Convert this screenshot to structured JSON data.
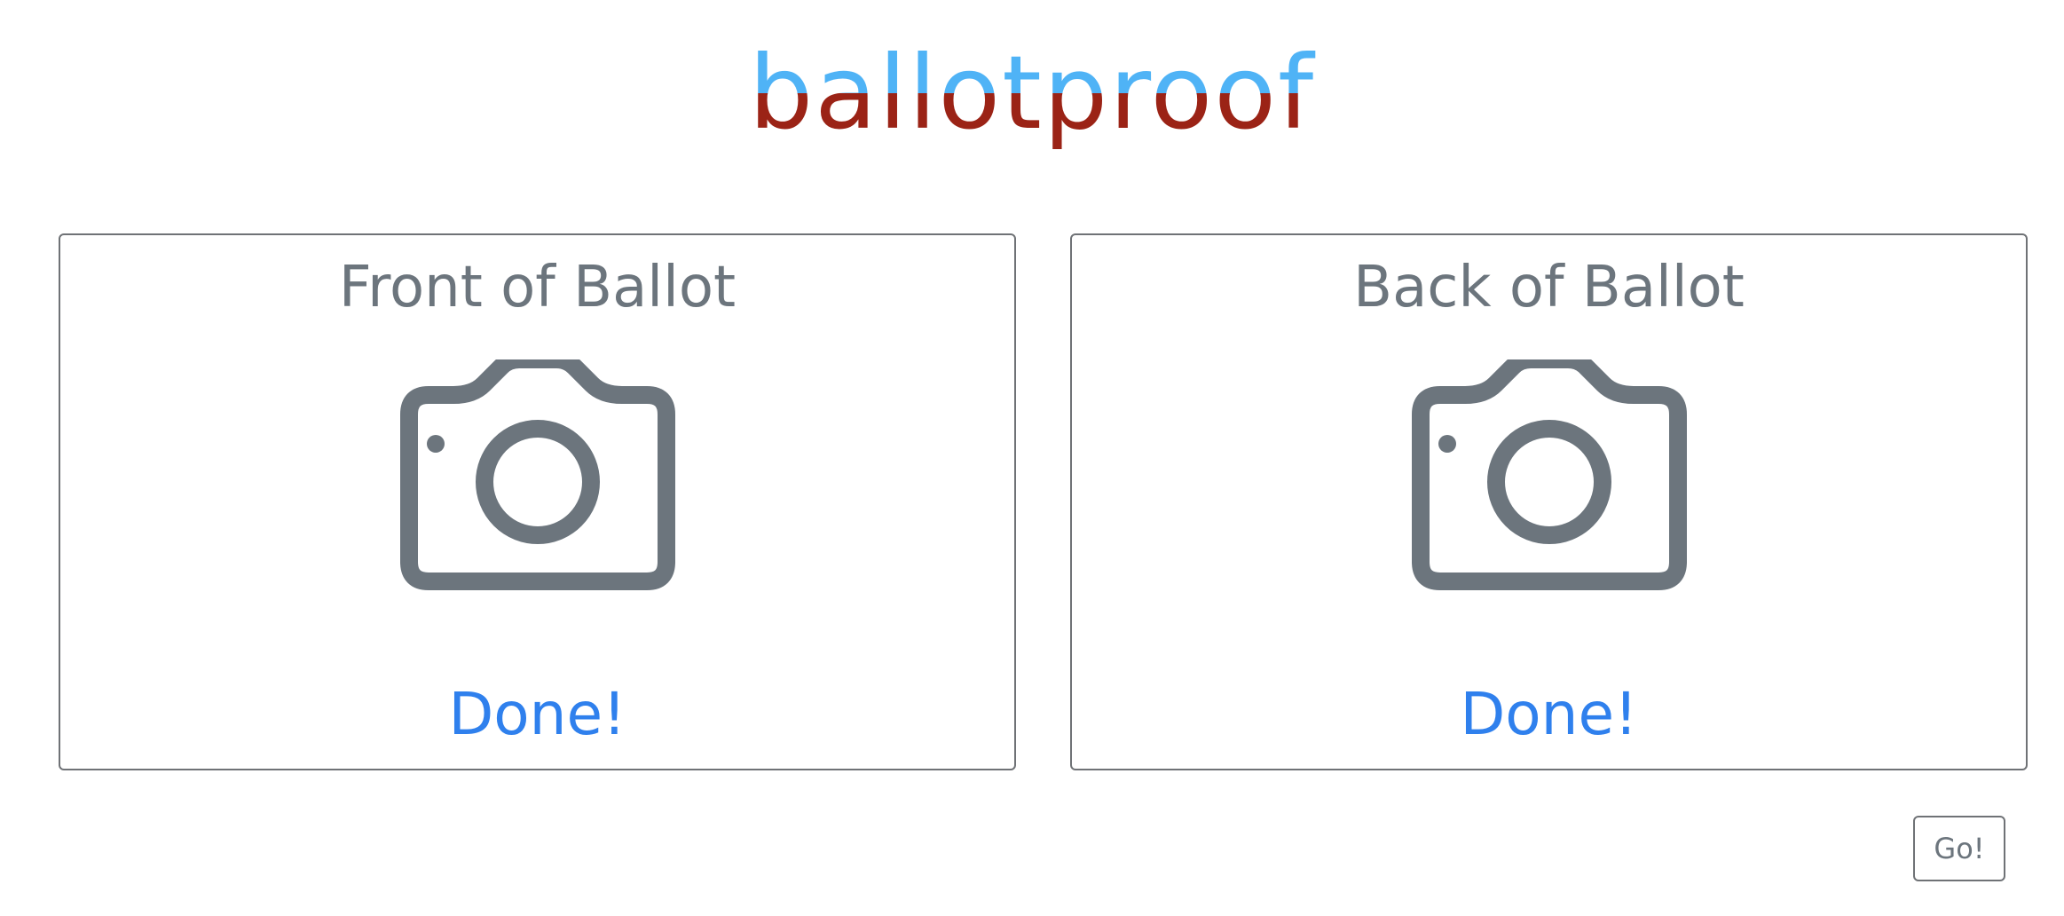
{
  "logo": {
    "text": "ballotproof",
    "colors": {
      "top": "#4fb3f6",
      "bottom": "#9b2316"
    }
  },
  "cards": {
    "front": {
      "title": "Front of Ballot",
      "icon": "camera-icon",
      "status": "Done!"
    },
    "back": {
      "title": "Back of Ballot",
      "icon": "camera-icon",
      "status": "Done!"
    }
  },
  "actions": {
    "go_label": "Go!"
  },
  "colors": {
    "muted": "#6c757d",
    "accent": "#2f80ed",
    "border": "#6f7276"
  }
}
